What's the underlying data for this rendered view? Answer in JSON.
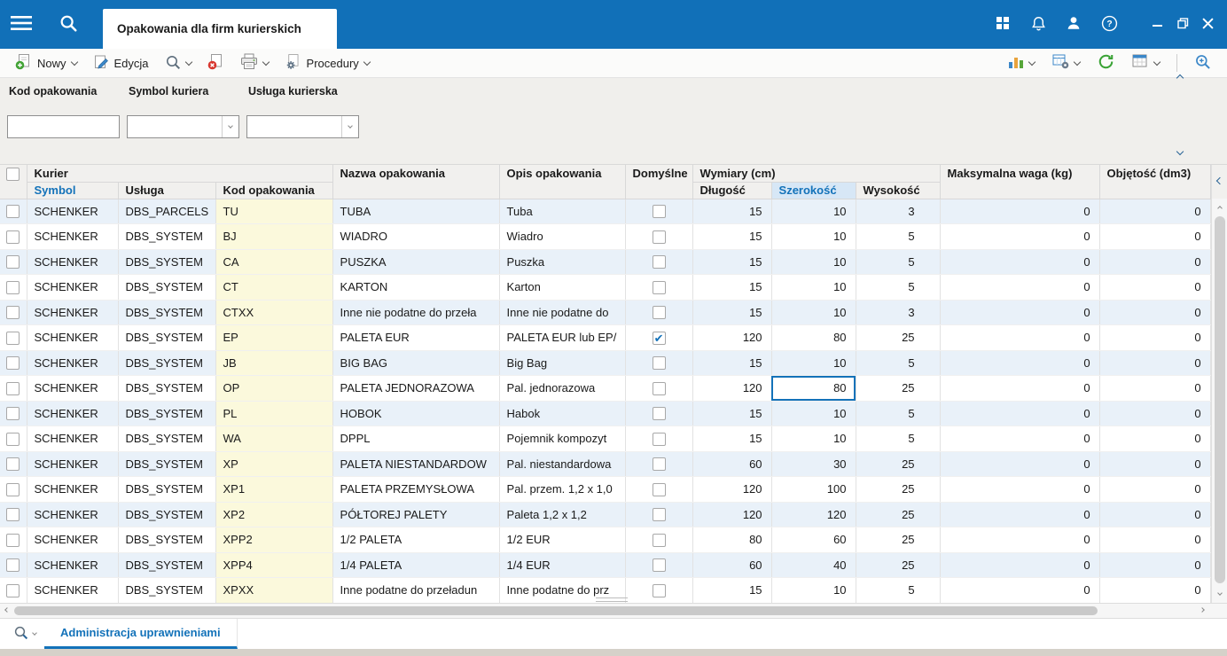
{
  "titlebar": {
    "tab_title": "Opakowania dla firm kurierskich"
  },
  "toolbar": {
    "new_label": "Nowy",
    "edit_label": "Edycja",
    "procedures_label": "Procedury",
    "icons": [
      "document-add",
      "edit-pencil",
      "magnifier-preview",
      "document-delete",
      "printer",
      "gear-procedures",
      "bar-chart",
      "grid-gear",
      "refresh",
      "grid-settings",
      "zoom-plus"
    ]
  },
  "filters": [
    {
      "label": "Kod opakowania",
      "value": "",
      "type": "text"
    },
    {
      "label": "Symbol kuriera",
      "value": "",
      "type": "select"
    },
    {
      "label": "Usługa kurierska",
      "value": "",
      "type": "select"
    }
  ],
  "table": {
    "group_headers": {
      "kurier": "Kurier",
      "nazwa": "Nazwa opakowania",
      "opis": "Opis opakowania",
      "domyslne": "Domyślne",
      "wymiary": "Wymiary (cm)",
      "waga": "Maksymalna waga (kg)",
      "objetosc": "Objętość (dm3)"
    },
    "sub_headers": {
      "symbol": "Symbol",
      "usluga": "Usługa",
      "kod": "Kod opakowania",
      "dlugosc": "Długość",
      "szerokosc": "Szerokość",
      "wysokosc": "Wysokość"
    },
    "selected_cell": {
      "row_index": 7,
      "field": "szerokosc"
    },
    "rows": [
      {
        "symbol": "SCHENKER",
        "usluga": "DBS_PARCELS",
        "kod": "TU",
        "nazwa": "TUBA",
        "opis": "Tuba",
        "domyslne": false,
        "dlugosc": 15,
        "szerokosc": 10,
        "wysokosc": 3,
        "waga": 0,
        "objetosc": 0
      },
      {
        "symbol": "SCHENKER",
        "usluga": "DBS_SYSTEM",
        "kod": "BJ",
        "nazwa": "WIADRO",
        "opis": "Wiadro",
        "domyslne": false,
        "dlugosc": 15,
        "szerokosc": 10,
        "wysokosc": 5,
        "waga": 0,
        "objetosc": 0
      },
      {
        "symbol": "SCHENKER",
        "usluga": "DBS_SYSTEM",
        "kod": "CA",
        "nazwa": "PUSZKA",
        "opis": "Puszka",
        "domyslne": false,
        "dlugosc": 15,
        "szerokosc": 10,
        "wysokosc": 5,
        "waga": 0,
        "objetosc": 0
      },
      {
        "symbol": "SCHENKER",
        "usluga": "DBS_SYSTEM",
        "kod": "CT",
        "nazwa": "KARTON",
        "opis": "Karton",
        "domyslne": false,
        "dlugosc": 15,
        "szerokosc": 10,
        "wysokosc": 5,
        "waga": 0,
        "objetosc": 0
      },
      {
        "symbol": "SCHENKER",
        "usluga": "DBS_SYSTEM",
        "kod": "CTXX",
        "nazwa": "Inne nie podatne do przeła",
        "opis": "Inne nie podatne do",
        "domyslne": false,
        "dlugosc": 15,
        "szerokosc": 10,
        "wysokosc": 3,
        "waga": 0,
        "objetosc": 0
      },
      {
        "symbol": "SCHENKER",
        "usluga": "DBS_SYSTEM",
        "kod": "EP",
        "nazwa": "PALETA EUR",
        "opis": "PALETA EUR lub EP/",
        "domyslne": true,
        "dlugosc": 120,
        "szerokosc": 80,
        "wysokosc": 25,
        "waga": 0,
        "objetosc": 0
      },
      {
        "symbol": "SCHENKER",
        "usluga": "DBS_SYSTEM",
        "kod": "JB",
        "nazwa": "BIG BAG",
        "opis": "Big Bag",
        "domyslne": false,
        "dlugosc": 15,
        "szerokosc": 10,
        "wysokosc": 5,
        "waga": 0,
        "objetosc": 0
      },
      {
        "symbol": "SCHENKER",
        "usluga": "DBS_SYSTEM",
        "kod": "OP",
        "nazwa": "PALETA JEDNORAZOWA",
        "opis": "Pal. jednorazowa",
        "domyslne": false,
        "dlugosc": 120,
        "szerokosc": 80,
        "wysokosc": 25,
        "waga": 0,
        "objetosc": 0
      },
      {
        "symbol": "SCHENKER",
        "usluga": "DBS_SYSTEM",
        "kod": "PL",
        "nazwa": "HOBOK",
        "opis": "Habok",
        "domyslne": false,
        "dlugosc": 15,
        "szerokosc": 10,
        "wysokosc": 5,
        "waga": 0,
        "objetosc": 0
      },
      {
        "symbol": "SCHENKER",
        "usluga": "DBS_SYSTEM",
        "kod": "WA",
        "nazwa": "DPPL",
        "opis": "Pojemnik kompozyt",
        "domyslne": false,
        "dlugosc": 15,
        "szerokosc": 10,
        "wysokosc": 5,
        "waga": 0,
        "objetosc": 0
      },
      {
        "symbol": "SCHENKER",
        "usluga": "DBS_SYSTEM",
        "kod": "XP",
        "nazwa": "PALETA NIESTANDARDOW",
        "opis": "Pal. niestandardowa",
        "domyslne": false,
        "dlugosc": 60,
        "szerokosc": 30,
        "wysokosc": 25,
        "waga": 0,
        "objetosc": 0
      },
      {
        "symbol": "SCHENKER",
        "usluga": "DBS_SYSTEM",
        "kod": "XP1",
        "nazwa": "PALETA PRZEMYSŁOWA",
        "opis": "Pal. przem. 1,2 x 1,0",
        "domyslne": false,
        "dlugosc": 120,
        "szerokosc": 100,
        "wysokosc": 25,
        "waga": 0,
        "objetosc": 0
      },
      {
        "symbol": "SCHENKER",
        "usluga": "DBS_SYSTEM",
        "kod": "XP2",
        "nazwa": "PÓŁTOREJ PALETY",
        "opis": "Paleta 1,2 x 1,2",
        "domyslne": false,
        "dlugosc": 120,
        "szerokosc": 120,
        "wysokosc": 25,
        "waga": 0,
        "objetosc": 0
      },
      {
        "symbol": "SCHENKER",
        "usluga": "DBS_SYSTEM",
        "kod": "XPP2",
        "nazwa": "1/2 PALETA",
        "opis": "1/2 EUR",
        "domyslne": false,
        "dlugosc": 80,
        "szerokosc": 60,
        "wysokosc": 25,
        "waga": 0,
        "objetosc": 0
      },
      {
        "symbol": "SCHENKER",
        "usluga": "DBS_SYSTEM",
        "kod": "XPP4",
        "nazwa": "1/4 PALETA",
        "opis": "1/4 EUR",
        "domyslne": false,
        "dlugosc": 60,
        "szerokosc": 40,
        "wysokosc": 25,
        "waga": 0,
        "objetosc": 0
      },
      {
        "symbol": "SCHENKER",
        "usluga": "DBS_SYSTEM",
        "kod": "XPXX",
        "nazwa": "Inne podatne do przeładun",
        "opis": "Inne podatne do prz",
        "domyslne": false,
        "dlugosc": 15,
        "szerokosc": 10,
        "wysokosc": 5,
        "waga": 0,
        "objetosc": 0
      }
    ]
  },
  "bottom_bar": {
    "tab_label": "Administracja uprawnieniami"
  },
  "colors": {
    "accent": "#1372b9",
    "titlebar": "#1170b8",
    "stripe": "#e9f1f9",
    "yellow": "#fbf9dc",
    "green": "#43a336",
    "red": "#d8372f"
  }
}
